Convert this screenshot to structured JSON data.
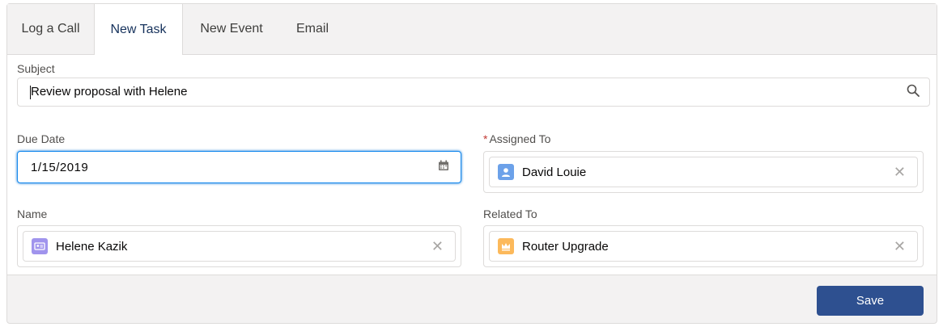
{
  "tabs": [
    {
      "label": "Log a Call"
    },
    {
      "label": "New Task"
    },
    {
      "label": "New Event"
    },
    {
      "label": "Email"
    }
  ],
  "active_tab": "New Task",
  "form": {
    "subject": {
      "label": "Subject",
      "value": "Review proposal with Helene"
    },
    "due_date": {
      "label": "Due Date",
      "value": "1/15/2019"
    },
    "assigned_to": {
      "required_mark": "*",
      "label": "Assigned To",
      "value": "David Louie",
      "icon": "user-icon",
      "icon_color": "#6ca1e9"
    },
    "name": {
      "label": "Name",
      "value": "Helene Kazik",
      "icon": "contact-icon",
      "icon_color": "#a094ed"
    },
    "related_to": {
      "label": "Related To",
      "value": "Router Upgrade",
      "icon": "opportunity-crown-icon",
      "icon_color": "#fcb95b"
    }
  },
  "actions": {
    "save_label": "Save"
  },
  "colors": {
    "accent": "#16325c",
    "focus": "#1589ee",
    "button": "#2e5090",
    "background": "#f3f2f2"
  }
}
